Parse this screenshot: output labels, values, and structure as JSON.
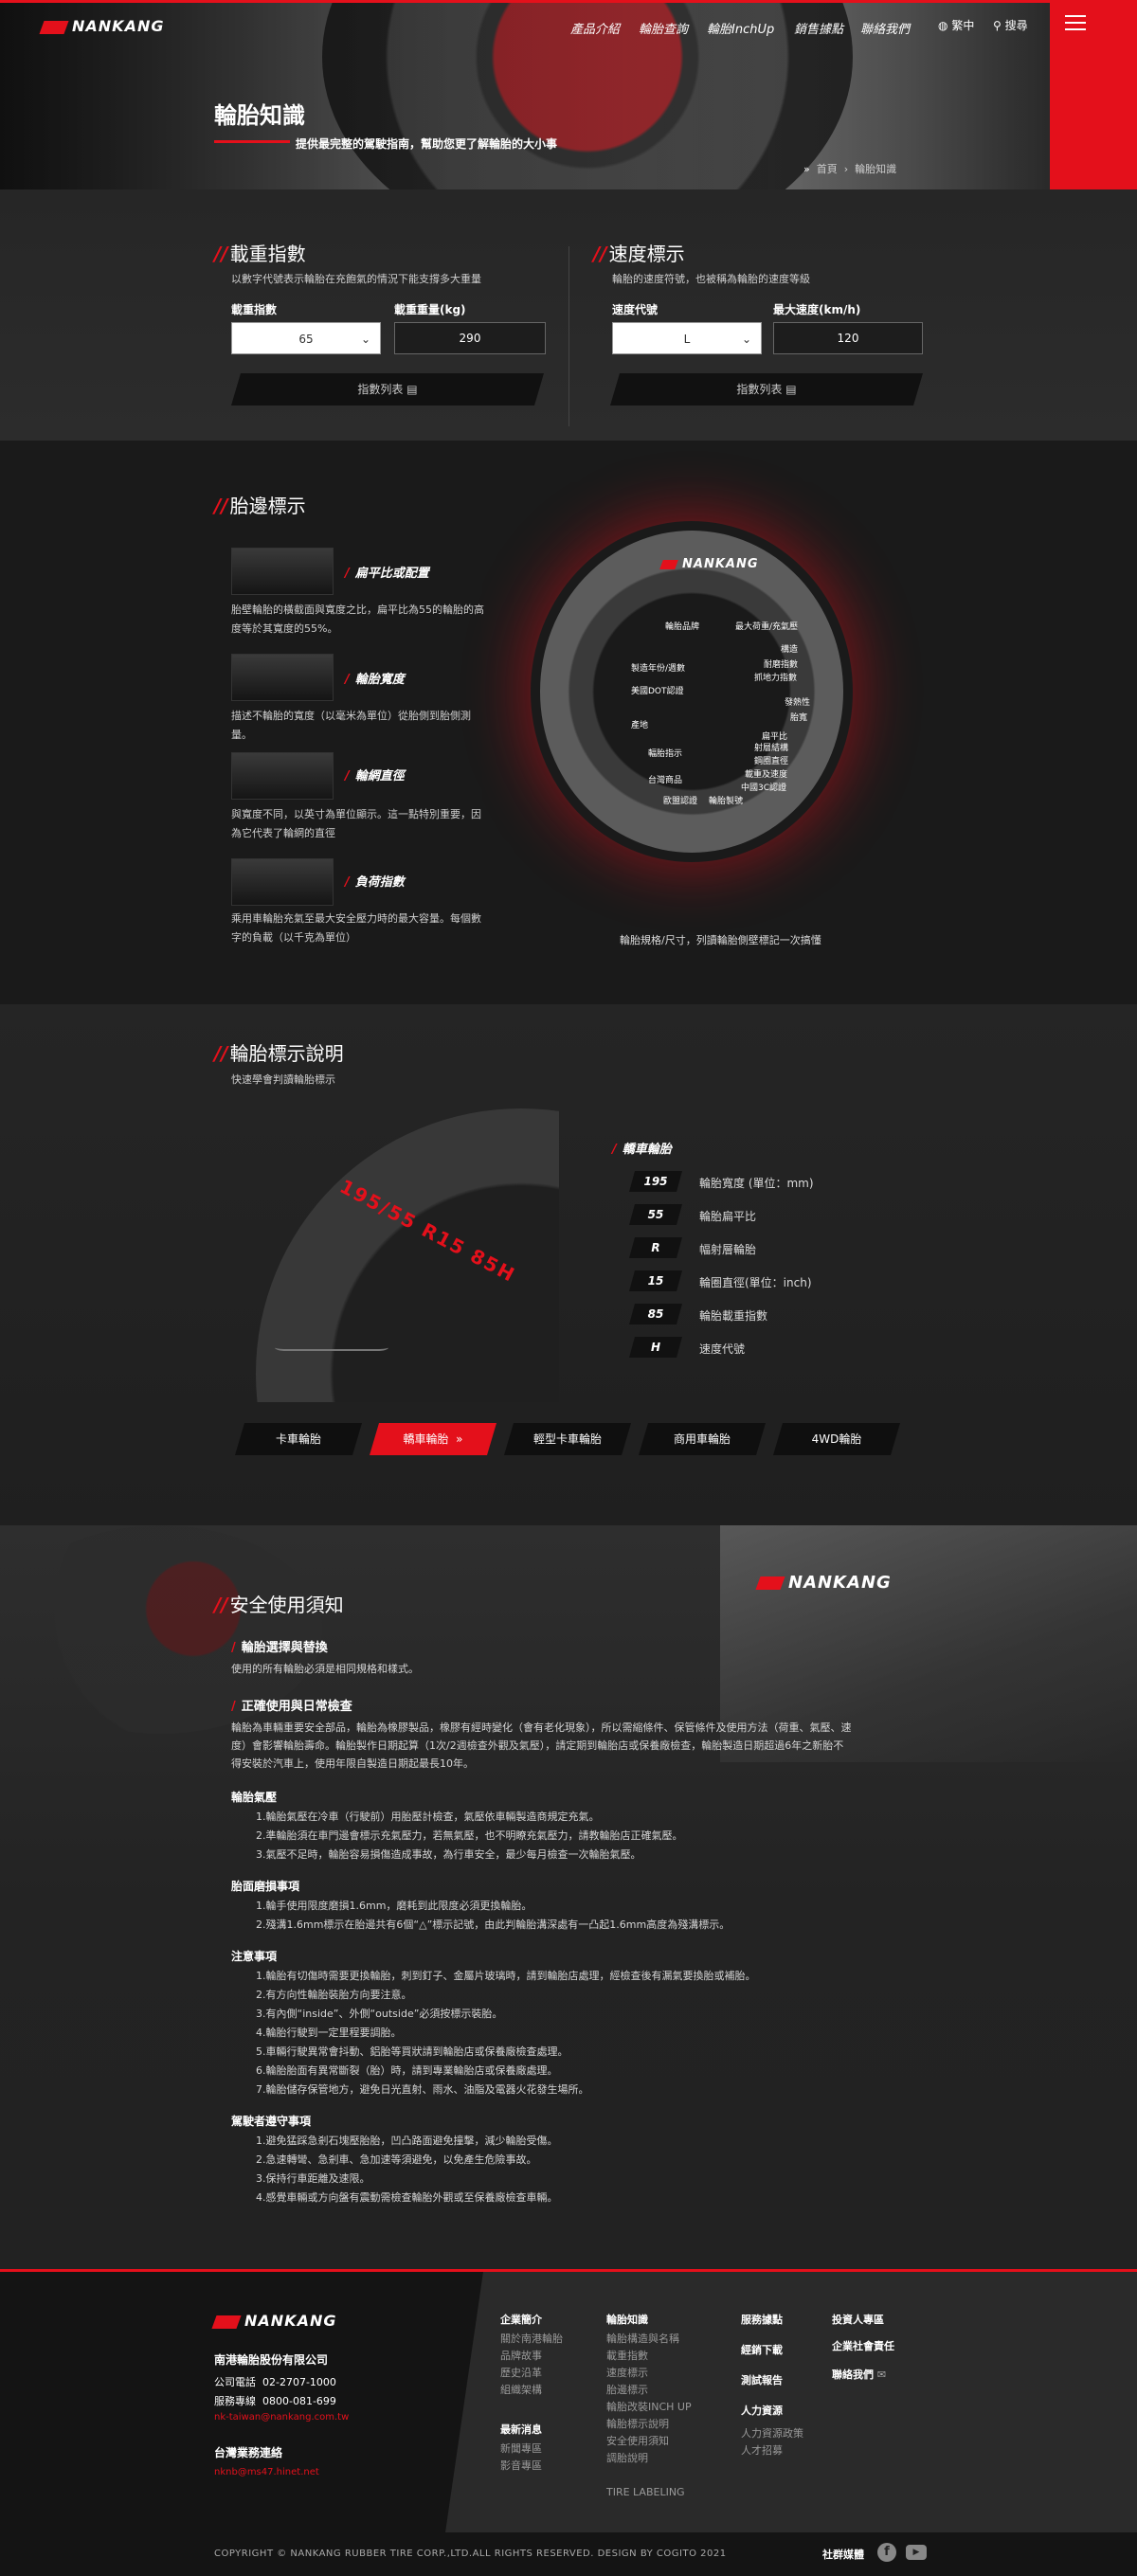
{
  "brand": "NANKANG",
  "nav": {
    "items": [
      "產品介紹",
      "輪胎查詢",
      "輪胎InchUp",
      "銷售據點",
      "聯絡我們"
    ],
    "lang": "繁中",
    "search": "搜尋"
  },
  "hero": {
    "title": "輪胎知識",
    "subtitle": "提供最完整的駕駛指南，幫助您更了解輪胎的大小事",
    "breadcrumb": [
      "首頁",
      "輪胎知識"
    ]
  },
  "load_index": {
    "title": "載重指數",
    "desc": "以數字代號表示輪胎在充飽氣的情況下能支撐多大重量",
    "label_index": "載重指數",
    "label_weight": "載重重量(kg)",
    "index_value": "65",
    "weight_value": "290",
    "list_button": "指數列表"
  },
  "speed": {
    "title": "速度標示",
    "desc": "輪胎的速度符號，也被稱為輪胎的速度等級",
    "label_code": "速度代號",
    "label_speed": "最大速度(km/h)",
    "code_value": "L",
    "speed_value": "120",
    "list_button": "指數列表"
  },
  "sidewall": {
    "title": "胎邊標示",
    "features": [
      {
        "name": "扁平比或配置",
        "desc1": "胎壁輪胎的橫截面與寬度之比，扁平比為55的輪胎的高",
        "desc2": "度等於其寬度的55%。"
      },
      {
        "name": "輪胎寬度",
        "desc1": "描述不輪胎的寬度（以毫米為單位）從胎側到胎側測",
        "desc2": "量。"
      },
      {
        "name": "輪網直徑",
        "desc1": "與寬度不同，以英寸為單位顯示。這一點特別重要，因",
        "desc2": "為它代表了輪網的直徑"
      },
      {
        "name": "負荷指數",
        "desc1": "乘用車輪胎充氣至最大安全壓力時的最大容量。每個數",
        "desc2": "字的負載（以千克為單位）"
      }
    ],
    "callouts_left": [
      "輪胎品牌",
      "製造年份/週數",
      "美國DOT認證",
      "產地",
      "輻胎指示",
      "台灣商品",
      "歐盟認證",
      "輪胎製號"
    ],
    "callouts_right": [
      "最大荷重/充氣壓",
      "構造",
      "耐磨指數",
      "抓地力指數",
      "發熱性",
      "胎寬",
      "扁平比",
      "射層結構",
      "鋼圈直徑",
      "載重及速度",
      "中國3C認證"
    ],
    "caption": "輪胎規格/尺寸，列讀輪胎側壁標記一次搞懂"
  },
  "marking": {
    "title": "輪胎標示說明",
    "desc": "快速學會判讀輪胎標示",
    "tire_text": "195/55 R15 85H",
    "category": "轎車輪胎",
    "codes": [
      {
        "code": "195",
        "desc": "輪胎寬度 (單位：mm)"
      },
      {
        "code": "55",
        "desc": "輪胎扁平比"
      },
      {
        "code": "R",
        "desc": "幅射層輪胎"
      },
      {
        "code": "15",
        "desc": "輪圈直徑(單位：inch)"
      },
      {
        "code": "85",
        "desc": "輪胎載重指數"
      },
      {
        "code": "H",
        "desc": "速度代號"
      }
    ],
    "tabs": [
      "卡車輪胎",
      "轎車輪胎",
      "輕型卡車輪胎",
      "商用車輪胎",
      "4WD輪胎"
    ],
    "active_tab": "轎車輪胎"
  },
  "safety": {
    "title": "安全使用須知",
    "sub1": "輪胎選擇與替換",
    "sub1_text": "使用的所有輪胎必須是相同規格和樣式。",
    "sub2": "正確使用與日常檢查",
    "intro1": "輪胎為車輛重要安全部品，輪胎為橡膠製品，橡膠有經時變化（會有老化現象），所以需縮條件、保管條件及使用方法（荷重、氣壓、速",
    "intro2": "度）會影響輪胎壽命。輪胎製作日期起算（1次/2週檢查外觀及氣壓），請定期到輪胎店或保養廠檢查，輪胎製造日期超過6年之新胎不",
    "intro3": "得安裝於汽車上，使用年限自製造日期起最長10年。",
    "groups": [
      {
        "heading": "輪胎氣壓",
        "items": [
          "1.輪胎氣壓在冷車（行駛前）用胎壓計檢查，氣壓依車輛製造商規定充氣。",
          "2.準輪胎須在車門邊會標示充氣壓力，若無氣壓，也不明瞭充氣壓力，請教輪胎店正確氣壓。",
          "3.氣壓不足時，輪胎容易損傷造成事故，為行車安全，最少每月檢查一次輪胎氣壓。"
        ]
      },
      {
        "heading": "胎面磨損事項",
        "items": [
          "1.輪手使用限度磨損1.6mm，磨耗到此限度必須更換輪胎。",
          "2.殘溝1.6mm標示在胎邊共有6個“△”標示記號，由此判輪胎溝深處有一凸起1.6mm高度為殘溝標示。"
        ]
      },
      {
        "heading": "注意事項",
        "items": [
          "1.輪胎有切傷時需要更換輪胎，刺到釘子、金屬片玻璃時，請到輪胎店處理，經檢查後有漏氣要換胎或補胎。",
          "2.有方向性輪胎裝胎方向要注意。",
          "3.有內側“inside”、外側“outside”必須按標示裝胎。",
          "4.輪胎行駛到一定里程要調胎。",
          "5.車輛行駛異常會抖動、鋁胎等買狀請到輪胎店或保養廠檢查處理。",
          "6.輪胎胎面有異常斷裂（胎）時，請到專業輪胎店或保養廠處理。",
          "7.輪胎儲存保管地方，避免日光直射、雨水、油脂及電器火花發生場所。"
        ]
      },
      {
        "heading": "駕駛者遵守事項",
        "items": [
          "1.避免猛踩急剎石塊壓胎胎，凹凸路面避免撞擊，減少輪胎受傷。",
          "2.急速轉彎、急剎車、急加速等須避免，以免產生危險事故。",
          "3.保持行車距離及速限。",
          "4.感覺車輛或方向盤有震動需檢查輪胎外觀或至保養廠檢查車輛。"
        ]
      }
    ]
  },
  "footer": {
    "company": "南港輪胎股份有限公司",
    "phone_label": "公司電話",
    "phone": "02-2707-1000",
    "service_label": "服務專線",
    "service": "0800-081-699",
    "email": "nk-taiwan@nankang.com.tw",
    "biz_title": "台灣業務連絡",
    "biz_email": "nknb@ms47.hinet.net",
    "cols": [
      {
        "head": "企業簡介",
        "items": [
          "關於南港輪胎",
          "品牌故事",
          "歷史沿革",
          "組織架構"
        ]
      },
      {
        "head2": "最新消息",
        "items2": [
          "新聞專區",
          "影音專區"
        ]
      },
      {
        "head": "輪胎知識",
        "items": [
          "輪胎構造與名稱",
          "載重指數",
          "速度標示",
          "胎邊標示",
          "輪胎改裝INCH UP",
          "輪胎標示說明",
          "安全使用須知",
          "調胎說明",
          "TIRE LABELING"
        ]
      },
      {
        "head": "服務據點",
        "head_b": "經銷下載",
        "head_c": "測試報告",
        "head_d": "人力資源",
        "items": [
          "人力資源政策",
          "人才招募"
        ]
      },
      {
        "head": "投資人專區",
        "head_b": "企業社會責任",
        "head_c": "聯絡我們"
      }
    ],
    "copyright": "COPYRIGHT © NANKANG RUBBER TIRE CORP.,LTD.ALL RIGHTS RESERVED. DESIGN BY COGITO 2021",
    "social": "社群媒體"
  }
}
